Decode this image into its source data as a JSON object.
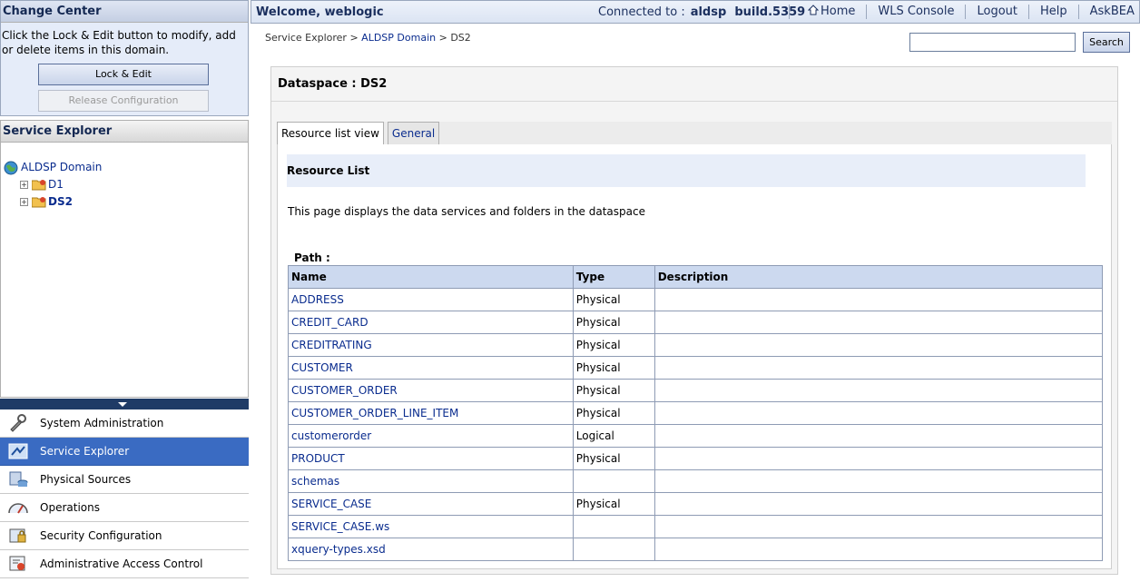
{
  "change_center": {
    "title": "Change Center",
    "text": "Click the Lock & Edit button to modify, add or delete items in this domain.",
    "lock_edit_label": "Lock & Edit",
    "release_label": "Release Configuration"
  },
  "service_explorer": {
    "title": "Service Explorer",
    "root": "ALDSP Domain",
    "children": [
      {
        "label": "D1",
        "active": false
      },
      {
        "label": "DS2",
        "active": true
      }
    ]
  },
  "nav": {
    "items": [
      {
        "label": "System Administration",
        "icon": "wrench-icon",
        "active": false
      },
      {
        "label": "Service Explorer",
        "icon": "service-explorer-icon",
        "active": true
      },
      {
        "label": "Physical Sources",
        "icon": "physical-sources-icon",
        "active": false
      },
      {
        "label": "Operations",
        "icon": "gauge-icon",
        "active": false
      },
      {
        "label": "Security Configuration",
        "icon": "security-icon",
        "active": false
      },
      {
        "label": "Administrative Access Control",
        "icon": "access-control-icon",
        "active": false
      }
    ]
  },
  "header": {
    "welcome": "Welcome, weblogic",
    "connected_label": "Connected to :",
    "connected_value": "aldsp  build.5359",
    "links": [
      "Home",
      "WLS Console",
      "Logout",
      "Help",
      "AskBEA"
    ]
  },
  "breadcrumb": {
    "root": "Service Explorer",
    "sep1": " > ",
    "link": "ALDSP Domain",
    "sep2": " > ",
    "current": "DS2"
  },
  "search": {
    "value": "",
    "button": "Search"
  },
  "main": {
    "title": "Dataspace : DS2",
    "tabs": [
      "Resource list view",
      "General"
    ],
    "section_title": "Resource List",
    "description": "This page displays the data services and folders in the dataspace",
    "path_label": "Path :",
    "columns": [
      "Name",
      "Type",
      "Description"
    ],
    "rows": [
      {
        "name": "ADDRESS",
        "type": "Physical",
        "description": ""
      },
      {
        "name": "CREDIT_CARD",
        "type": "Physical",
        "description": ""
      },
      {
        "name": "CREDITRATING",
        "type": "Physical",
        "description": ""
      },
      {
        "name": "CUSTOMER",
        "type": "Physical",
        "description": ""
      },
      {
        "name": "CUSTOMER_ORDER",
        "type": "Physical",
        "description": ""
      },
      {
        "name": "CUSTOMER_ORDER_LINE_ITEM",
        "type": "Physical",
        "description": ""
      },
      {
        "name": "customerorder",
        "type": "Logical",
        "description": ""
      },
      {
        "name": "PRODUCT",
        "type": "Physical",
        "description": ""
      },
      {
        "name": "schemas",
        "type": "",
        "description": ""
      },
      {
        "name": "SERVICE_CASE",
        "type": "Physical",
        "description": ""
      },
      {
        "name": "SERVICE_CASE.ws",
        "type": "",
        "description": ""
      },
      {
        "name": "xquery-types.xsd",
        "type": "",
        "description": ""
      }
    ]
  }
}
